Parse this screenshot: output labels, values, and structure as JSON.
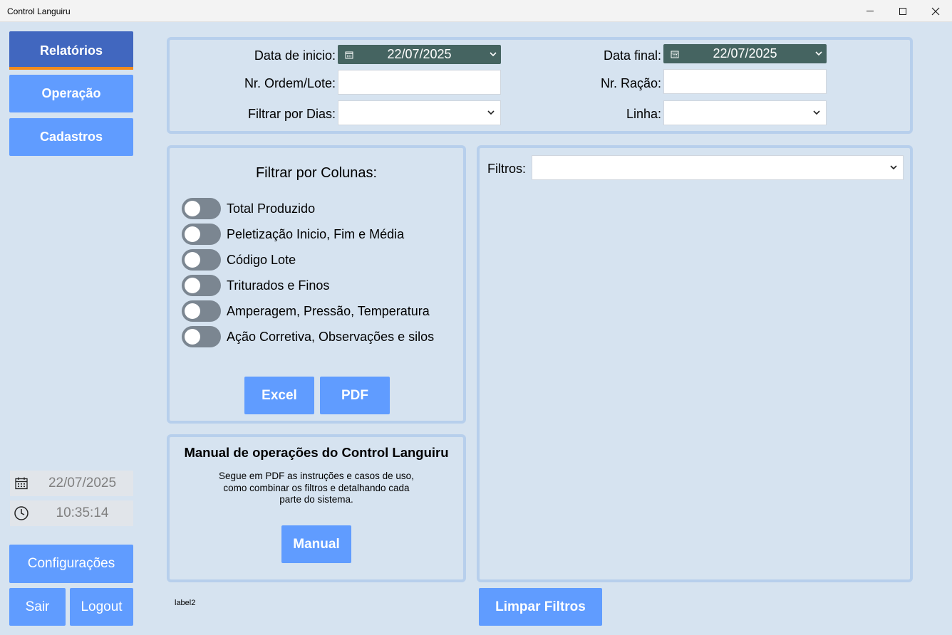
{
  "window": {
    "title": "Control Languiru"
  },
  "nav": {
    "relatorios": "Relatórios",
    "operacao": "Operação",
    "cadastros": "Cadastros"
  },
  "clock": {
    "date": "22/07/2025",
    "time": "10:35:14"
  },
  "footer_nav": {
    "configuracoes": "Configurações",
    "sair": "Sair",
    "logout": "Logout"
  },
  "filters": {
    "data_inicio_label": "Data de inicio:",
    "data_inicio_value": "22/07/2025",
    "data_final_label": "Data final:",
    "data_final_value": "22/07/2025",
    "ordem_label": "Nr. Ordem/Lote:",
    "ordem_value": "",
    "racao_label": "Nr. Ração:",
    "racao_value": "",
    "dias_label": "Filtrar por Dias:",
    "dias_value": "",
    "linha_label": "Linha:",
    "linha_value": ""
  },
  "columns": {
    "title": "Filtrar por Colunas:",
    "toggles": [
      {
        "label": "Total Produzido",
        "on": false
      },
      {
        "label": "Peletização Inicio, Fim e Média",
        "on": false
      },
      {
        "label": "Código Lote",
        "on": false
      },
      {
        "label": "Triturados e Finos",
        "on": false
      },
      {
        "label": "Amperagem, Pressão, Temperatura",
        "on": false
      },
      {
        "label": "Ação Corretiva, Observações e silos",
        "on": false
      }
    ],
    "excel": "Excel",
    "pdf": "PDF"
  },
  "manual": {
    "title": "Manual de operações do Control Languiru",
    "desc_line1": "Segue em PDF as instruções e casos de uso,",
    "desc_line2": "como combinar os filtros e detalhando cada",
    "desc_line3": "parte do sistema.",
    "button": "Manual"
  },
  "results": {
    "filtros_label": "Filtros:",
    "filtros_value": ""
  },
  "label2": "label2",
  "limpar": "Limpar Filtros",
  "colors": {
    "nav_blue": "#609cff",
    "nav_active": "#4167bf",
    "active_accent": "#f28b1c",
    "date_picker": "#456461",
    "background": "#d6e3f0"
  }
}
